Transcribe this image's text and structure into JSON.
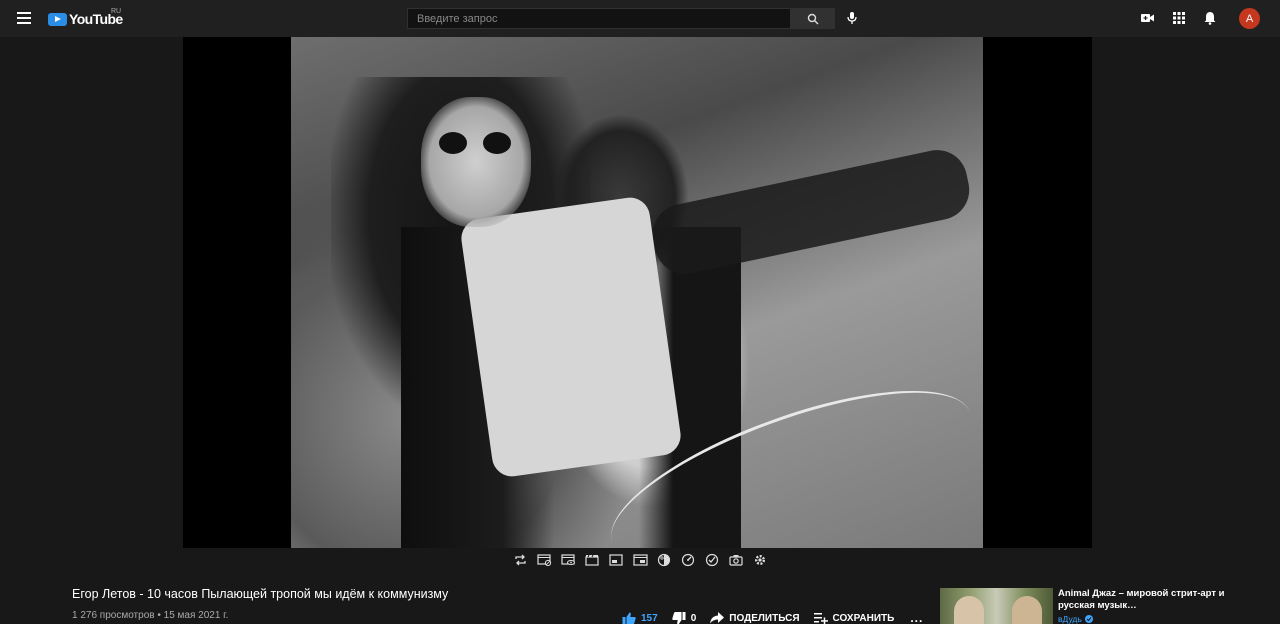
{
  "header": {
    "logo_text": "YouTube",
    "logo_region": "RU",
    "search_placeholder": "Введите запрос",
    "avatar_letter": "A",
    "icons": [
      "menu-icon",
      "search-icon",
      "mic-icon",
      "create-video-icon",
      "apps-icon",
      "notifications-icon"
    ]
  },
  "player": {
    "toolbar_icons": [
      "loop-icon",
      "screenshot-off-icon",
      "cinema-icon",
      "clapperboard-icon",
      "window-icon",
      "mini-player-icon",
      "filters-icon",
      "speed-icon",
      "audio-icon",
      "camera-icon",
      "settings-icon"
    ]
  },
  "video": {
    "title": "Егор Летов - 10 часов Пылающей тропой мы идём к коммунизму",
    "meta": "1 276 просмотров • 15 мая 2021 г.",
    "likes": "157",
    "dislikes": "0",
    "share_label": "ПОДЕЛИТЬСЯ",
    "save_label": "СОХРАНИТЬ",
    "more_label": "..."
  },
  "recommendation": {
    "title": "Animal Джаz – мировой стрит-арт и русская музык…",
    "channel": "вДудь"
  },
  "colors": {
    "background": "#181818",
    "header": "#202020",
    "accent_blue": "#3ea6ff",
    "avatar": "#c6371f"
  }
}
